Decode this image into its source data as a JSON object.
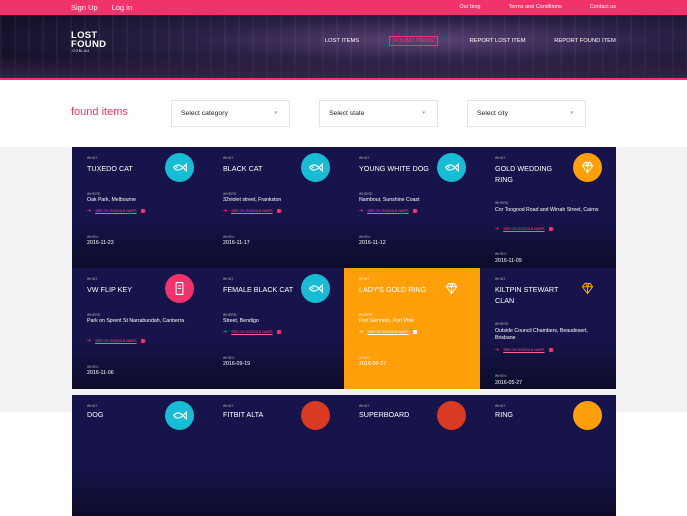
{
  "topbar": {
    "sign_up": "Sign Up",
    "log_in": "Log in",
    "our_blog": "Our blog",
    "terms": "Terms and Conditions",
    "contact": "Contact us"
  },
  "logo": {
    "line1": "LOST",
    "line2": "FOUND",
    "line3": ".COM.AU"
  },
  "nav": {
    "lost_items": "LOST ITEMS",
    "found_items": "FOUND ITEMS",
    "report_lost": "REPORT LOST ITEM",
    "report_found": "REPORT FOUND ITEM"
  },
  "filters": {
    "title": "found items",
    "category": "Select category",
    "state": "Select state",
    "city": "Select city"
  },
  "labels": {
    "what": "WHAT:",
    "where": "WHERE:",
    "when": "WHEN:",
    "map": "SEE ON GOOGLE MAPS"
  },
  "colors": {
    "accent": "#f0336b",
    "navy": "#16144a",
    "teal": "#18bcd4",
    "orange": "#ff9f0a"
  },
  "items": [
    {
      "title": "TUXEDO CAT",
      "where": "Oak Park, Melbourne",
      "date": "2016-11-23",
      "icon": "fish-icon"
    },
    {
      "title": "BLACK CAT",
      "where": "32violet street, Frankston",
      "date": "2016-11-17",
      "icon": "fish-icon"
    },
    {
      "title": "YOUNG WHITE DOG",
      "where": "Nambour, Sunshine Coast",
      "date": "2016-11-12",
      "icon": "fish-icon"
    },
    {
      "title": "GOLD WEDDING RING",
      "where": "Cnr Toogood Road and Wirrah Street, Cairns",
      "date": "2016-11-09",
      "icon": "diamond-icon"
    },
    {
      "title": "VW FLIP KEY",
      "where": "Park on Sprent St Narrabundah, Canberra",
      "date": "2016-11-06",
      "icon": "phone-icon"
    },
    {
      "title": "FEMALE BLACK CAT",
      "where": "Street, Bendigo",
      "date": "2016-09-19",
      "icon": "fish-icon"
    },
    {
      "title": "LADY'S GOLD RING",
      "where": "Port Germein, Port Pirie",
      "date": "2016-09-27",
      "icon": "diamond-icon"
    },
    {
      "title": "KILTPIN STEWART CLAN",
      "where": "Outside Council Chambers, Beaudesert, Brisbane",
      "date": "2016-05-27",
      "icon": "diamond-icon"
    },
    {
      "title": "DOG",
      "icon": "fish-icon"
    },
    {
      "title": "FITBIT ALTA",
      "icon": "generic-icon"
    },
    {
      "title": "SUPERBOARD",
      "icon": "generic-icon"
    },
    {
      "title": "RING",
      "icon": "diamond-icon"
    }
  ]
}
